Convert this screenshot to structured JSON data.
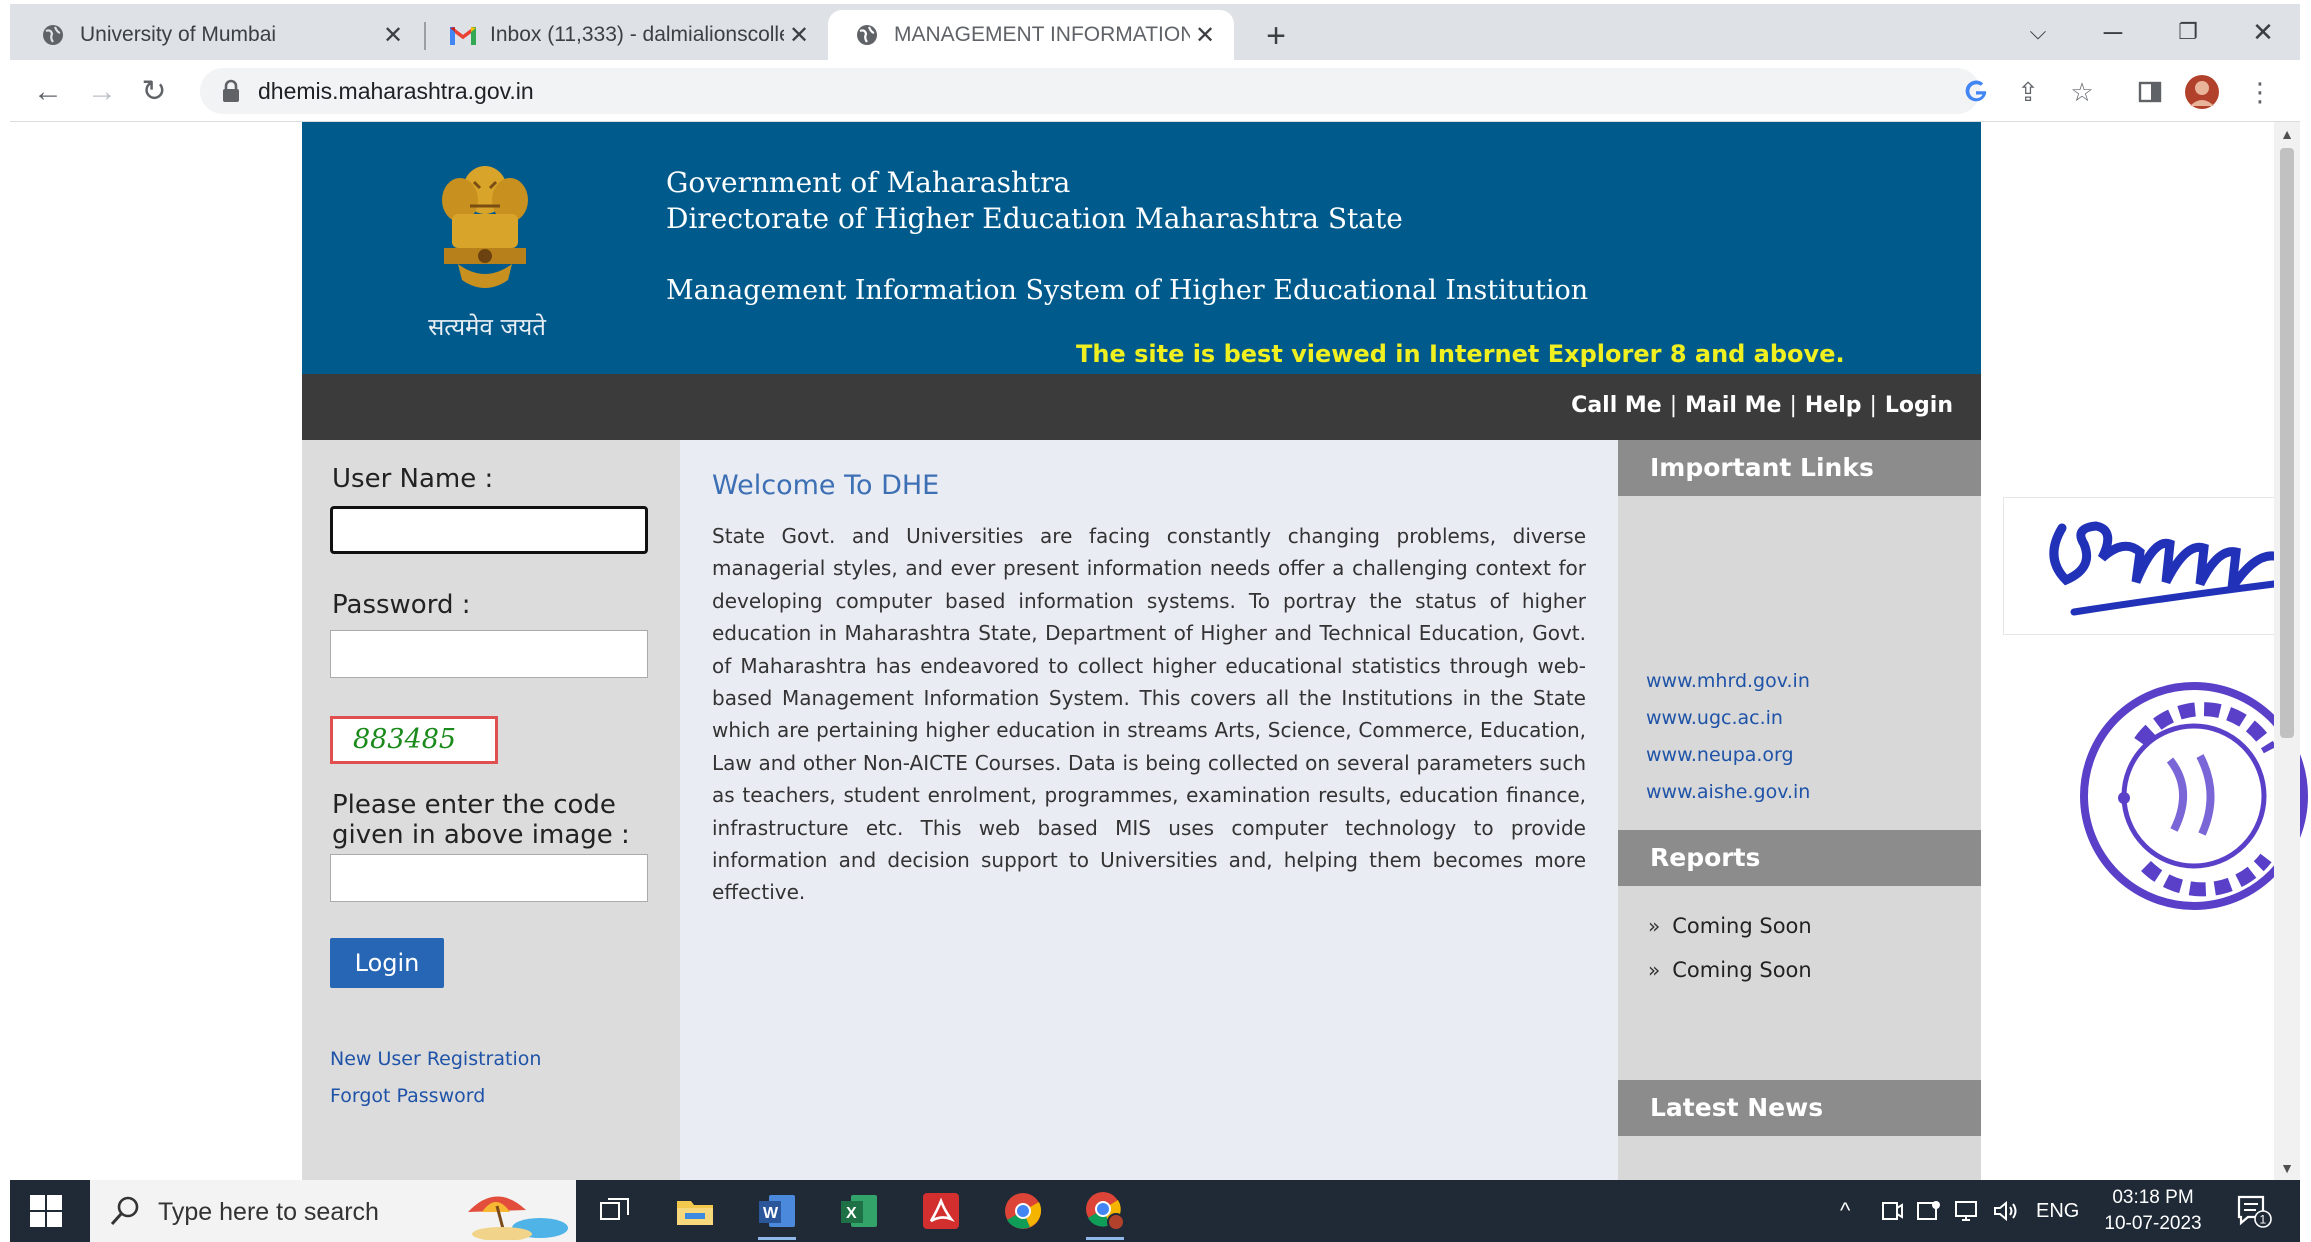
{
  "browser": {
    "tabs": [
      {
        "title": "University of Mumbai",
        "close": "✕"
      },
      {
        "title": "Inbox (11,333) - dalmialionscolle",
        "close": "✕"
      },
      {
        "title": "MANAGEMENT INFORMATION S",
        "close": "✕"
      }
    ],
    "new_tab": "+",
    "url": "dhemis.maharashtra.gov.in"
  },
  "header": {
    "motto": "सत्यमेव जयते",
    "line1": "Government of Maharashtra",
    "line2": "Directorate of Higher Education Maharashtra State",
    "line3": "Management Information System of Higher Educational Institution",
    "ie_notice": "The site is best viewed in Internet Explorer 8 and above."
  },
  "topnav": {
    "call": "Call Me",
    "mail": "Mail Me",
    "help": "Help",
    "login": "Login",
    "sep": "|"
  },
  "login": {
    "username_label": "User Name :",
    "password_label": "Password :",
    "captcha_code": "883485",
    "captcha_label_1": "Please enter the code",
    "captcha_label_2": "given in above image :",
    "button": "Login",
    "new_user": "New User Registration",
    "forgot": "Forgot Password"
  },
  "main": {
    "welcome": "Welcome To DHE",
    "description": "State Govt. and Universities are facing constantly changing problems, diverse managerial styles, and ever present information needs offer a challenging context for developing computer based information systems. To portray the status of higher education in Maharashtra State, Department of Higher and Technical Education, Govt. of Maharashtra has endeavored to collect higher educational statistics through web-based Management Information System. This covers all the Institutions in the State which are pertaining higher education in streams Arts, Science, Commerce, Education, Law and other Non-AICTE Courses. Data is being collected on several parameters such as teachers, student enrolment, programmes, examination results, education finance, infrastructure etc. This web based MIS uses computer technology to provide information and decision support to Universities and, helping them becomes more effective."
  },
  "right": {
    "important_links": "Important Links",
    "links": [
      "www.mhrd.gov.in",
      "www.ugc.ac.in",
      "www.neupa.org",
      "www.aishe.gov.in"
    ],
    "reports": "Reports",
    "report_items": [
      "Coming Soon",
      "Coming Soon"
    ],
    "latest_news": "Latest News"
  },
  "taskbar": {
    "search_placeholder": "Type here to search",
    "lang": "ENG",
    "time": "03:18 PM",
    "date": "10-07-2023",
    "notif_count": "1"
  },
  "colors": {
    "header_blue": "#005b8c",
    "nav_dark": "#3b3b3b",
    "link_blue": "#1f53a8",
    "ie_notice": "#f0f020",
    "login_button": "#2766b5"
  }
}
